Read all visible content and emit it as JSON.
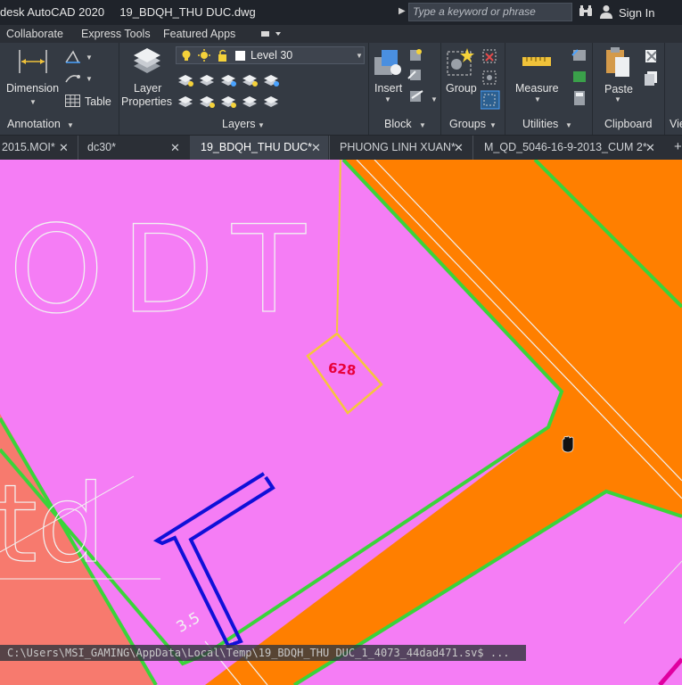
{
  "title_bar": {
    "app_title": "desk AutoCAD 2020",
    "filename": "19_BDQH_THU DUC.dwg",
    "search_placeholder": "Type a keyword or phrase",
    "sign_in": "Sign In"
  },
  "menu": {
    "items": [
      "Collaborate",
      "Express Tools",
      "Featured Apps"
    ]
  },
  "ribbon": {
    "annotation": {
      "dimension": "Dimension",
      "table": "Table",
      "label": "Annotation"
    },
    "layers": {
      "layer_properties_1": "Layer",
      "layer_properties_2": "Properties",
      "current_layer": "Level 30",
      "label": "Layers"
    },
    "block": {
      "insert": "Insert",
      "label": "Block"
    },
    "groups": {
      "group": "Group",
      "label": "Groups"
    },
    "utilities": {
      "measure": "Measure",
      "label": "Utilities"
    },
    "clipboard": {
      "paste": "Paste",
      "label": "Clipboard"
    },
    "view": {
      "label": "Vie"
    }
  },
  "tabs": [
    {
      "label": "2015.MOI*"
    },
    {
      "label": "dc30*"
    },
    {
      "label": "19_BDQH_THU DUC*"
    },
    {
      "label": "PHUONG LINH XUAN*"
    },
    {
      "label": "M_QD_5046-16-9-2013_CUM 2*"
    }
  ],
  "drawing": {
    "zone_text": "ODT",
    "parcel_number": "628",
    "dimension_text": "3.5",
    "colors": {
      "pink": "#f57df5",
      "orange": "#ff7f00",
      "salmon": "#f77a6e",
      "green": "#3ad43a",
      "blue": "#1010d8",
      "yellow": "#f6c63b",
      "red_text": "#e8003a"
    }
  },
  "command_line": {
    "text": "C:\\Users\\MSI_GAMING\\AppData\\Local\\Temp\\19_BDQH_THU DUC_1_4073_44dad471.sv$ ..."
  }
}
